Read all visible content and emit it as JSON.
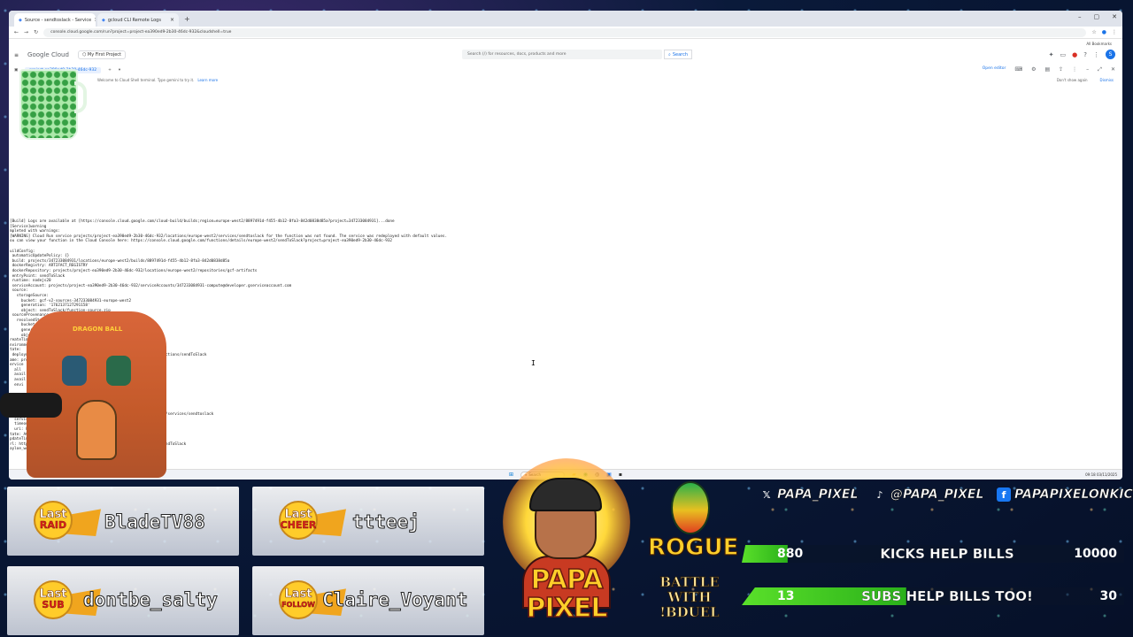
{
  "browser": {
    "tabs": [
      {
        "label": "Source - sendtoslack - Service"
      },
      {
        "label": "gcloud CLI Remote Logs"
      }
    ],
    "new_tab": "+",
    "url": "console.cloud.google.com/run?project=project-ea390ed9-2b30-46dc-932&cloudshell=true",
    "bookmarks": "All Bookmarks"
  },
  "console": {
    "brand": "Google Cloud",
    "project": "My First Project",
    "search_placeholder": "Search (/) for resources, docs, products and more",
    "search_button": "Search",
    "avatar_letter": "S"
  },
  "cloudshell": {
    "tab": "project-ea390ed9-2b30-46dc-932",
    "open_editor": "Open editor",
    "info_text": "Welcome to Cloud Shell terminal. Type gemini to try it.",
    "learn_more": "Learn more",
    "dont_show": "Don't show again",
    "dismiss": "Dismiss",
    "terminal_lines": [
      "[Build] Logs are available at [https://console.cloud.google.com/cloud-build/builds;region=europe-west2/8897491d-f455-4b12-8fa3-842d0838d85a?project=347233084931]...done",
      "[Service]warning",
      "mpleted with warnings:",
      "[WARNING] Cloud Run service projects/project-ea390ed9-2b30-46dc-932/locations/europe-west2/services/sendtoslack for the function was not found. The service was redeployed with default values.",
      "ou can view your function in the Cloud Console here: https://console.cloud.google.com/functions/details/europe-west2/sendToSlack?project=project-ea390ed9-2b30-46dc-932",
      "",
      "uildConfig:",
      " automaticUpdatePolicy: {}",
      " build: projects/347233084931/locations/europe-west2/builds/8897491d-f455-4b12-8fa3-842d0838d85a",
      " dockerRegistry: ARTIFACT_REGISTRY",
      " dockerRepository: projects/project-ea390ed9-2b30-46dc-932/locations/europe-west2/repositories/gcf-artifacts",
      " entryPoint: sendToSlack",
      " runtime: nodejs20",
      " serviceAccount: projects/project-ea390ed9-2b30-46dc-932/serviceAccounts/347233084931-compute@developer.gserviceaccount.com",
      " source:",
      "   storageSource:",
      "     bucket: gcf-v2-sources-347233084931-europe-west2",
      "     generation: '1762137127291158'",
      "     object: sendToSlack/function-source.zip",
      " sourceProvenance:",
      "   resolvedStorageSource:",
      "     bucket: gcf-v2-sources-347233084931-europe-west2",
      "     generation: '17",
      "     object: sendToSlack/",
      "reateTime: '2025-1",
      "nvironment: GEN_2",
      "tate:",
      " deployment-tool:                                   europe-west2/functions/sendToSlack",
      "ame: project",
      "ervice",
      "  all",
      "  avail",
      "  avail",
      "  envi",
      "",
      "",
      "",
      "  ingressSettings: ALLOW_ALL",
      "  maxInstanceCount",
      "  service: projects/pr                                  europe-west2/services/sendtoslack",
      "  serviceAccountEmail:                                  account.com",
      "  timeoutSeconds: 60",
      "  uri: https://sendto",
      "tate: ACTIVE",
      "pdateTime: '2025-11-0",
      "rl: https://europe-west                               nctions.net/sendToSlack",
      "ayloe_work_888@cloudshell                              46dc-932)$ "
    ]
  },
  "taskbar": {
    "search": "Search",
    "clock": "09:18 03/11/2025"
  },
  "overlay": {
    "last_panels": [
      {
        "l1": "Last",
        "l2": "RAID",
        "name": "BladeTV88"
      },
      {
        "l1": "Last",
        "l2": "CHEER",
        "name": "ttteej"
      },
      {
        "l1": "Last",
        "l2": "SUB",
        "name": "dontbe_salty"
      },
      {
        "l1": "Last",
        "l2": "FOLLOW",
        "name": "Claire_Voyant"
      }
    ],
    "logo_text": "PAPA PIXEL",
    "rogue": "ROGUE",
    "battle": [
      "BATTLE",
      "WITH",
      "!BDUEL"
    ],
    "chair_logo": "DRAGON BALL",
    "socials": [
      {
        "icon": "x-icon",
        "glyph": "𝕏",
        "text": "PAPA_PIXEL",
        "color": "#000000"
      },
      {
        "icon": "tiktok-icon",
        "glyph": "♪",
        "text": "@PAPA_PIXEL",
        "color": "#111111"
      },
      {
        "icon": "facebook-icon",
        "glyph": "f",
        "text": "PAPAPIXELONKICK",
        "color": "#1877f2"
      }
    ],
    "goals": [
      {
        "current": "880",
        "title": "KICKS HELP BILLS",
        "target": "10000",
        "fraction": 0.088
      },
      {
        "current": "13",
        "title": "SUBS HELP BILLS TOO!",
        "target": "30",
        "fraction": 0.43
      }
    ]
  }
}
